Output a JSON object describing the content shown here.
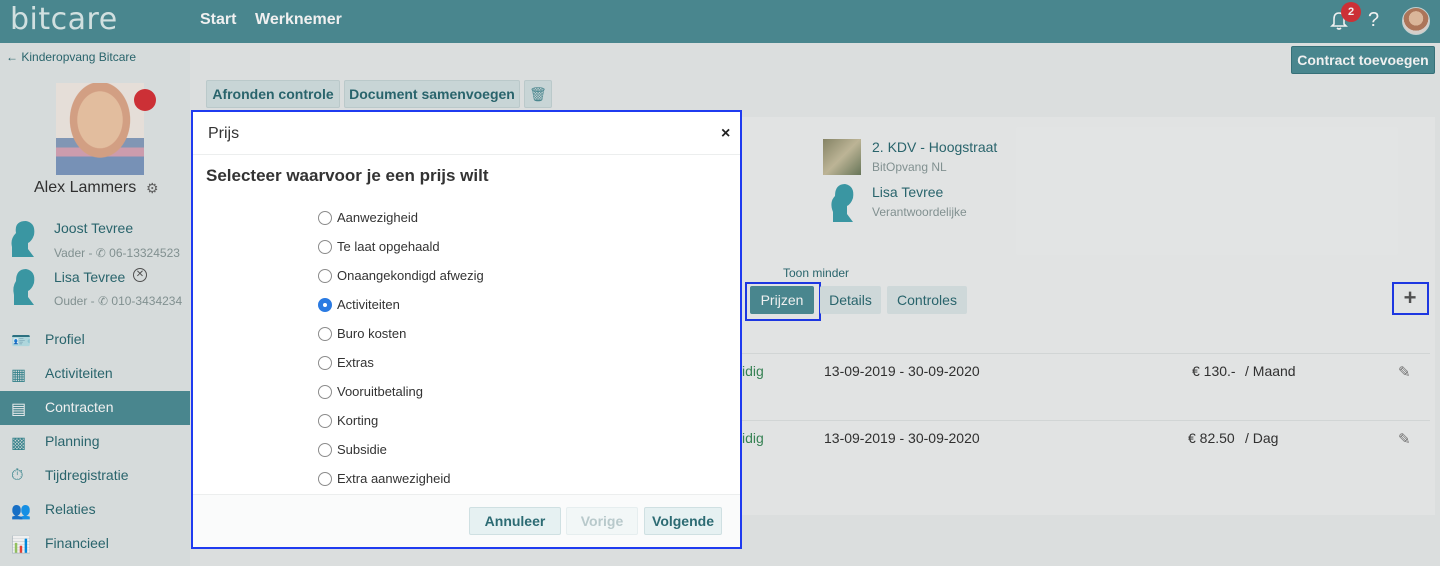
{
  "topbar": {
    "logo": "bitcare",
    "nav": [
      "Start",
      "Werknemer"
    ],
    "notification_count": "2",
    "help": "?"
  },
  "sidebar": {
    "back_label": "Kinderopvang Bitcare",
    "child_name": "Alex Lammers",
    "guardians": [
      {
        "name": "Joost Tevree",
        "sub": "Vader - ✆ 06-13324523"
      },
      {
        "name": "Lisa Tevree",
        "sub": "Ouder - ✆ 010-3434234"
      }
    ],
    "menu": [
      {
        "label": "Profiel",
        "icon": "id-card-icon"
      },
      {
        "label": "Activiteiten",
        "icon": "table-icon"
      },
      {
        "label": "Contracten",
        "icon": "contract-icon",
        "active": true
      },
      {
        "label": "Planning",
        "icon": "calendar-icon"
      },
      {
        "label": "Tijdregistratie",
        "icon": "stopwatch-icon"
      },
      {
        "label": "Relaties",
        "icon": "people-icon"
      },
      {
        "label": "Financieel",
        "icon": "bar-chart-icon"
      }
    ]
  },
  "toolbar": {
    "add_contract": "Contract toevoegen",
    "afronden": "Afronden controle",
    "samenvoegen": "Document samenvoegen"
  },
  "contract": {
    "location_title": "2. KDV - Hoogstraat",
    "location_sub": "BitOpvang NL",
    "responsible_name": "Lisa Tevree",
    "responsible_sub": "Verantwoordelijke",
    "toon_minder": "Toon minder",
    "tabs": [
      "Prijzen",
      "Details",
      "Controles"
    ],
    "plus": "+",
    "rows": [
      {
        "status": "idig",
        "period": "13-09-2019 - 30-09-2020",
        "amount": "€ 130.-",
        "unit": "/ Maand"
      },
      {
        "status": "idig",
        "period": "13-09-2019 - 30-09-2020",
        "amount": "€ 82.50",
        "unit": "/ Dag"
      }
    ]
  },
  "modal": {
    "title": "Prijs",
    "close": "×",
    "heading": "Selecteer waarvoor je een prijs wilt",
    "options": [
      {
        "label": "Aanwezigheid",
        "checked": false
      },
      {
        "label": "Te laat opgehaald",
        "checked": false
      },
      {
        "label": "Onaangekondigd afwezig",
        "checked": false
      },
      {
        "label": "Activiteiten",
        "checked": true
      },
      {
        "label": "Buro kosten",
        "checked": false
      },
      {
        "label": "Extras",
        "checked": false
      },
      {
        "label": "Vooruitbetaling",
        "checked": false
      },
      {
        "label": "Korting",
        "checked": false
      },
      {
        "label": "Subsidie",
        "checked": false
      },
      {
        "label": "Extra aanwezigheid",
        "checked": false
      }
    ],
    "buttons": {
      "cancel": "Annuleer",
      "prev": "Vorige",
      "next": "Volgende"
    }
  },
  "colors": {
    "brand": "#4e8f97",
    "highlight": "#1f3bf0",
    "alert": "#d9343a"
  }
}
